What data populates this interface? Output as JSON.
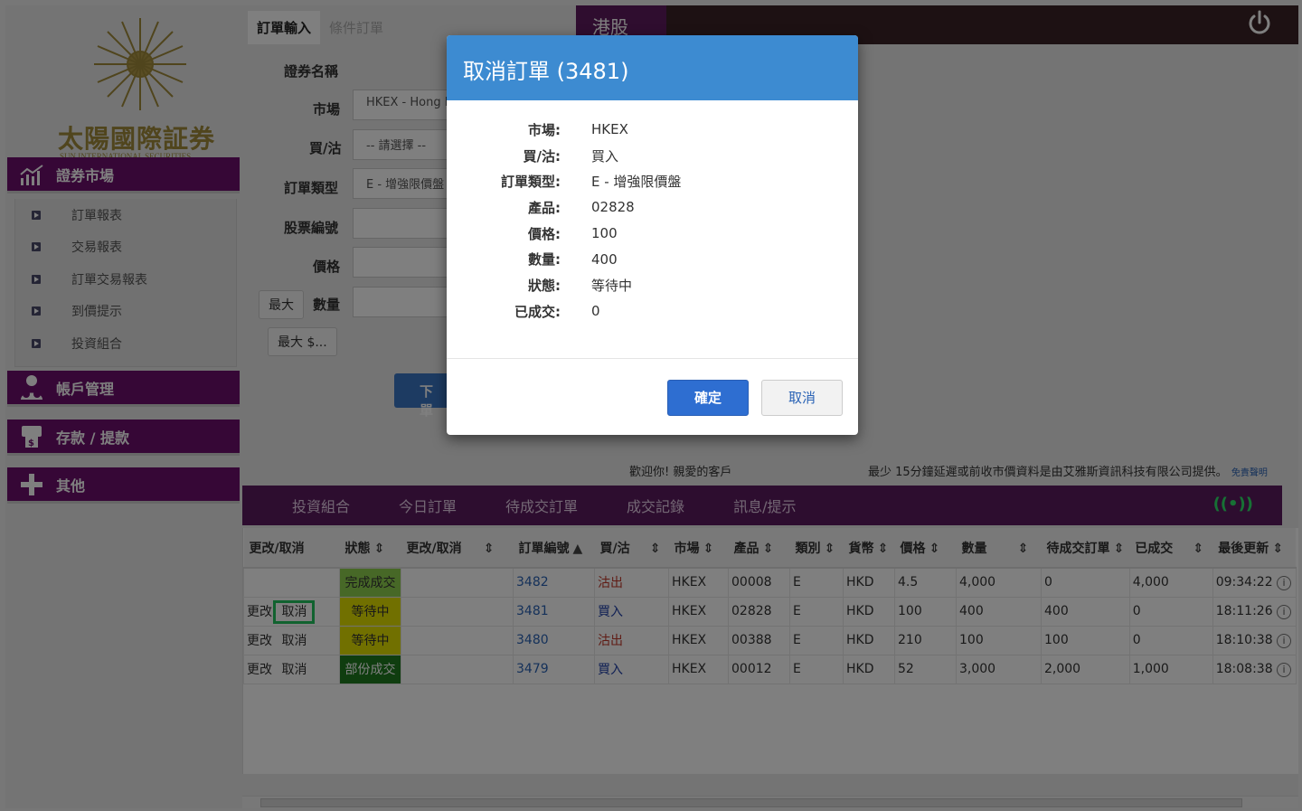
{
  "company": {
    "name_cn": "太陽國際証券",
    "name_en": "SUN INTERNATIONAL SECURITIES"
  },
  "sidebar": {
    "sections": [
      {
        "label": "證券市場",
        "icon": "chart-icon"
      },
      {
        "label": "帳戶管理",
        "icon": "users-icon"
      },
      {
        "label": "存款 / 提款",
        "icon": "atm-icon"
      },
      {
        "label": "其他",
        "icon": "plus-icon"
      }
    ],
    "subitems": [
      "訂單報表",
      "交易報表",
      "訂單交易報表",
      "到價提示",
      "投資組合"
    ]
  },
  "entry": {
    "tabs": [
      "訂單輸入",
      "條件訂單"
    ],
    "labels": {
      "security_name": "證券名稱",
      "market": "市場",
      "side": "買/沽",
      "order_type": "訂單類型",
      "stock_code": "股票編號",
      "price": "價格",
      "quantity": "數量"
    },
    "values": {
      "market": "HKEX - Hong Kong",
      "side": "-- 請選擇 --",
      "order_type": "E - 增強限價盤"
    },
    "max_button": "最大",
    "max_amount_button": "最大 $...",
    "submit": "下單"
  },
  "banner": {
    "market_tab": "港股"
  },
  "status": {
    "welcome": "歡迎你! 親愛的客戶",
    "delay_note": "最少 15分鐘延遲或前收市價資料是由艾雅斯資訊科技有限公司提供。",
    "disclaimer_link": "免責聲明"
  },
  "bottom_nav": [
    "投資組合",
    "今日訂單",
    "待成交訂單",
    "成交記錄",
    "訊息/提示"
  ],
  "table": {
    "headers": [
      "更改/取消",
      "狀態",
      "更改/取消",
      "訂單編號",
      "買/沽",
      "市場",
      "產品",
      "類別",
      "貨幣",
      "價格",
      "數量",
      "待成交訂單",
      "已成交",
      "最後更新"
    ],
    "actions": {
      "modify": "更改",
      "cancel": "取消"
    },
    "rows": [
      {
        "status": "完成成交",
        "status_color": "#8fd14f",
        "order_no": "3482",
        "side": "沽出",
        "side_class": "sell",
        "market": "HKEX",
        "product": "00008",
        "type": "E",
        "currency": "HKD",
        "price": "4.5",
        "qty": "4,000",
        "pending": "0",
        "filled": "4,000",
        "updated": "09:34:22",
        "actions": false
      },
      {
        "status": "等待中",
        "status_color": "#e3e000",
        "order_no": "3481",
        "side": "買入",
        "side_class": "buy",
        "market": "HKEX",
        "product": "02828",
        "type": "E",
        "currency": "HKD",
        "price": "100",
        "qty": "400",
        "pending": "400",
        "filled": "0",
        "updated": "18:11:26",
        "actions": true
      },
      {
        "status": "等待中",
        "status_color": "#e3e000",
        "order_no": "3480",
        "side": "沽出",
        "side_class": "sell",
        "market": "HKEX",
        "product": "00388",
        "type": "E",
        "currency": "HKD",
        "price": "210",
        "qty": "100",
        "pending": "100",
        "filled": "0",
        "updated": "18:10:38",
        "actions": true
      },
      {
        "status": "部份成交",
        "status_color": "#1f7a1f",
        "order_no": "3479",
        "side": "買入",
        "side_class": "buy",
        "market": "HKEX",
        "product": "00012",
        "type": "E",
        "currency": "HKD",
        "price": "52",
        "qty": "3,000",
        "pending": "2,000",
        "filled": "1,000",
        "updated": "18:08:38",
        "actions": true
      }
    ]
  },
  "modal": {
    "title": "取消訂單 (3481)",
    "fields": [
      {
        "label": "市場:",
        "value": "HKEX"
      },
      {
        "label": "買/沽:",
        "value": "買入"
      },
      {
        "label": "訂單類型:",
        "value": "E - 增強限價盤"
      },
      {
        "label": "產品:",
        "value": "02828"
      },
      {
        "label": "價格:",
        "value": "100"
      },
      {
        "label": "數量:",
        "value": "400"
      },
      {
        "label": "狀態:",
        "value": "等待中"
      },
      {
        "label": "已成交:",
        "value": "0"
      }
    ],
    "confirm": "確定",
    "cancel": "取消"
  },
  "colors": {
    "brand_purple": "#6d0e6d",
    "modal_header": "#3d8bd1",
    "primary_button": "#2e6ed1"
  }
}
